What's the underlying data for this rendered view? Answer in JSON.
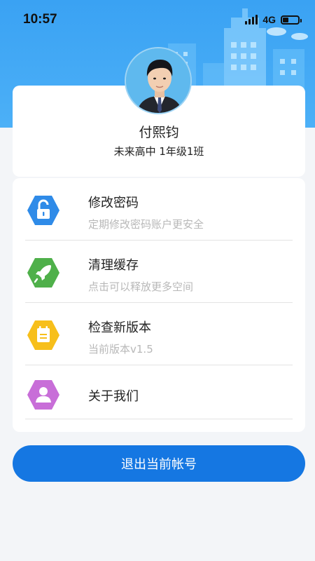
{
  "status_bar": {
    "time": "10:57",
    "network": "4G"
  },
  "profile": {
    "name": "付熙钧",
    "class_info": "未来高中 1年级1班"
  },
  "menu": {
    "items": [
      {
        "title": "修改密码",
        "subtitle": "定期修改密码账户更安全",
        "icon": "unlock-icon",
        "color": "#2f8be8"
      },
      {
        "title": "清理缓存",
        "subtitle": "点击可以释放更多空间",
        "icon": "rocket-icon",
        "color": "#4fb04a"
      },
      {
        "title": "检查新版本",
        "subtitle": "当前版本v1.5",
        "icon": "calendar-icon",
        "color": "#f7bf1b"
      },
      {
        "title": "关于我们",
        "subtitle": "",
        "icon": "user-icon",
        "color": "#c86ed8"
      }
    ]
  },
  "logout": {
    "label": "退出当前帐号",
    "color": "#1577e2"
  },
  "colors": {
    "header": "#3aa2f3",
    "background": "#f3f5f8"
  }
}
